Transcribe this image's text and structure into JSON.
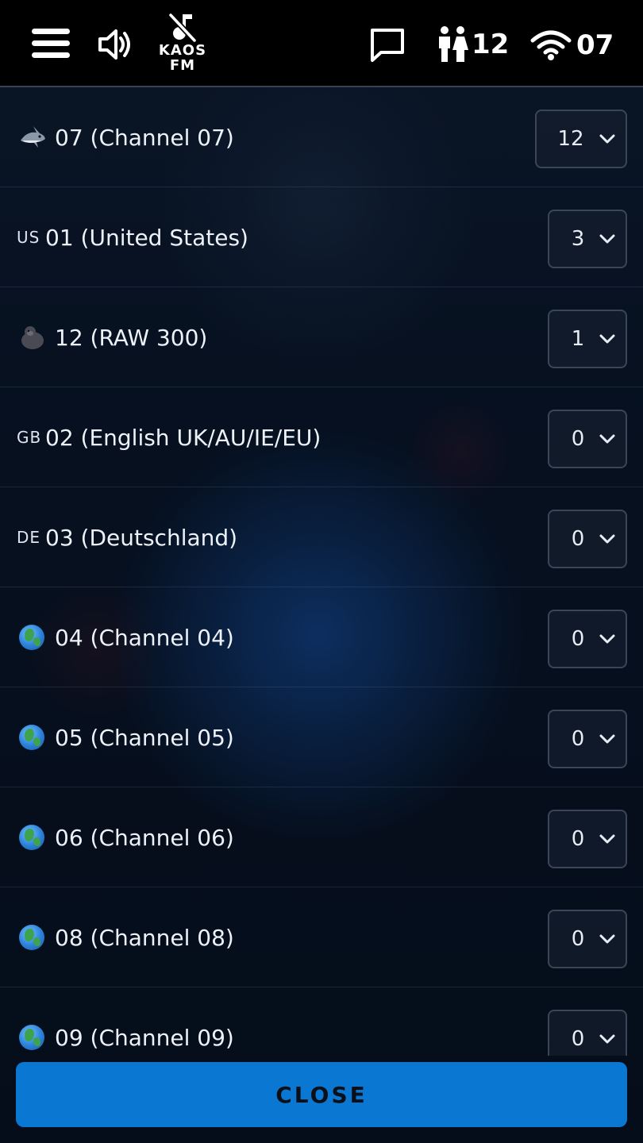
{
  "topbar": {
    "station_label_line1": "KAOS",
    "station_label_line2": "FM",
    "users_count": "12",
    "channel_number": "07"
  },
  "channels": [
    {
      "icon": "shark-emoji",
      "flag_text": "",
      "label": "07 (Channel 07)",
      "selected": "12"
    },
    {
      "icon": "flag-code",
      "flag_text": "US",
      "label": "01 (United States)",
      "selected": "3"
    },
    {
      "icon": "gorilla-emoji",
      "flag_text": "",
      "label": "12 (RAW 300)",
      "selected": "1"
    },
    {
      "icon": "flag-code",
      "flag_text": "GB",
      "label": "02 (English UK/AU/IE/EU)",
      "selected": "0"
    },
    {
      "icon": "flag-code",
      "flag_text": "DE",
      "label": "03 (Deutschland)",
      "selected": "0"
    },
    {
      "icon": "globe-emoji",
      "flag_text": "",
      "label": "04 (Channel 04)",
      "selected": "0"
    },
    {
      "icon": "globe-emoji",
      "flag_text": "",
      "label": "05 (Channel 05)",
      "selected": "0"
    },
    {
      "icon": "globe-emoji",
      "flag_text": "",
      "label": "06 (Channel 06)",
      "selected": "0"
    },
    {
      "icon": "globe-emoji",
      "flag_text": "",
      "label": "08 (Channel 08)",
      "selected": "0"
    },
    {
      "icon": "globe-emoji",
      "flag_text": "",
      "label": "09 (Channel 09)",
      "selected": "0"
    }
  ],
  "close_button": {
    "label": "CLOSE"
  },
  "colors": {
    "accent": "#0a78d2",
    "topbar_bg": "#000000",
    "page_bg": "#06101f"
  }
}
